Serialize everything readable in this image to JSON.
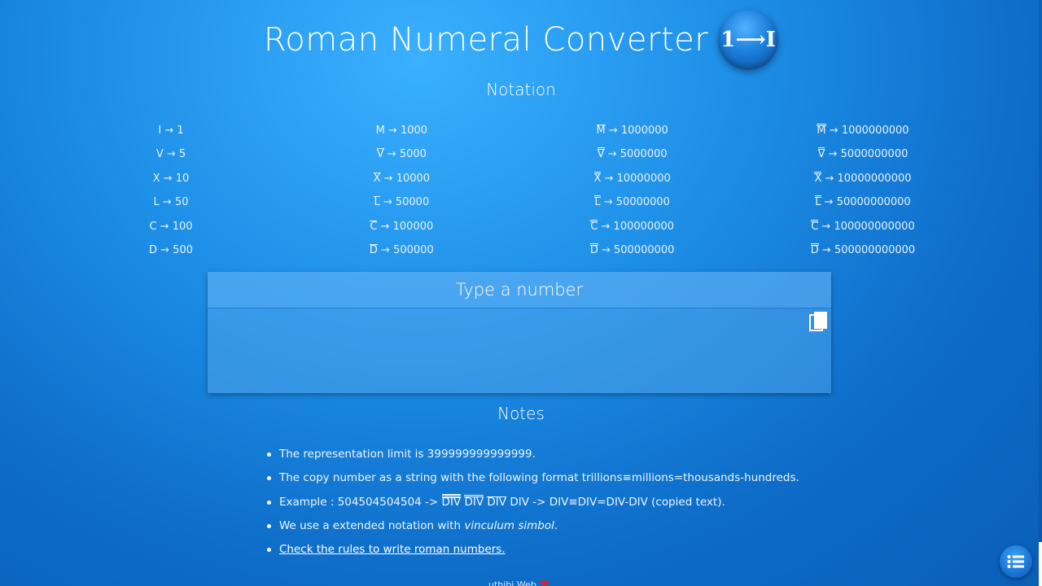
{
  "header": {
    "title": "Roman Numeral Converter",
    "logo_text": "1⟶I"
  },
  "notation": {
    "title": "Notation",
    "columns": [
      [
        {
          "sym": "I",
          "val": "1",
          "bar": 0
        },
        {
          "sym": "V",
          "val": "5",
          "bar": 0
        },
        {
          "sym": "X",
          "val": "10",
          "bar": 0
        },
        {
          "sym": "L",
          "val": "50",
          "bar": 0
        },
        {
          "sym": "C",
          "val": "100",
          "bar": 0
        },
        {
          "sym": "D",
          "val": "500",
          "bar": 0
        }
      ],
      [
        {
          "sym": "M",
          "val": "1000",
          "bar": 0
        },
        {
          "sym": "V",
          "val": "5000",
          "bar": 1
        },
        {
          "sym": "X",
          "val": "10000",
          "bar": 1
        },
        {
          "sym": "L",
          "val": "50000",
          "bar": 1
        },
        {
          "sym": "C",
          "val": "100000",
          "bar": 1
        },
        {
          "sym": "D",
          "val": "500000",
          "bar": 1
        }
      ],
      [
        {
          "sym": "M",
          "val": "1000000",
          "bar": 1
        },
        {
          "sym": "V",
          "val": "5000000",
          "bar": 2
        },
        {
          "sym": "X",
          "val": "10000000",
          "bar": 2
        },
        {
          "sym": "L",
          "val": "50000000",
          "bar": 2
        },
        {
          "sym": "C",
          "val": "100000000",
          "bar": 2
        },
        {
          "sym": "D",
          "val": "500000000",
          "bar": 2
        }
      ],
      [
        {
          "sym": "M",
          "val": "1000000000",
          "bar": 2
        },
        {
          "sym": "V",
          "val": "5000000000",
          "bar": 2
        },
        {
          "sym": "X",
          "val": "10000000000",
          "bar": 2
        },
        {
          "sym": "L",
          "val": "50000000000",
          "bar": 2
        },
        {
          "sym": "C",
          "val": "100000000000",
          "bar": 2
        },
        {
          "sym": "D",
          "val": "500000000000",
          "bar": 2
        }
      ]
    ]
  },
  "converter": {
    "header": "Type a number",
    "input_value": "",
    "copy_icon": "copy-icon"
  },
  "notes": {
    "title": "Notes",
    "limit_prefix": "The representation limit is ",
    "limit_value": "399999999999999.",
    "copy_format": "The copy number as a string with the following format trillions≡millions=thousands-hundreds.",
    "example_prefix": "Example : 504504504504 -> ",
    "example_div": "DIV",
    "example_suffix": " -> DIV≡DIV=DIV-DIV (copied text).",
    "extended_prefix": "We use a extended notation with ",
    "extended_em": "vinculum simbol",
    "extended_suffix": ".",
    "rules_link": "Check the rules to write roman numbers."
  },
  "footer": {
    "text": "uthibi Web",
    "heart_icon": "heart-icon"
  },
  "fab": {
    "icon": "list-menu-icon"
  },
  "colors": {
    "background": "#1e90e8",
    "panel": "#5aaaf0",
    "accent": "#1a74d4",
    "heart": "#e21b2a"
  }
}
